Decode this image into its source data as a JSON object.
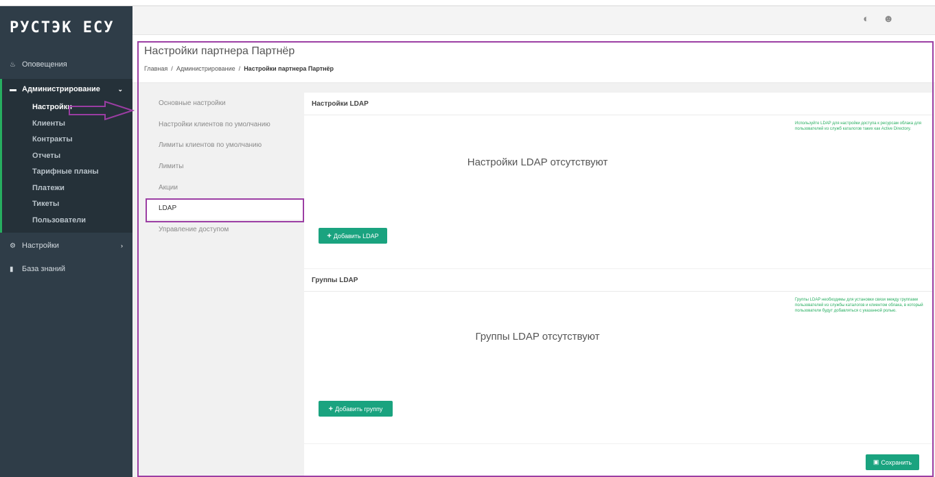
{
  "brand": {
    "logo": "РУСТЭК ЕСУ"
  },
  "sidebar": {
    "notifications": "Оповещения",
    "admin": {
      "label": "Администрирование",
      "items": [
        "Настройки",
        "Клиенты",
        "Контракты",
        "Отчеты",
        "Тарифные планы",
        "Платежи",
        "Тикеты",
        "Пользователи"
      ]
    },
    "settings": "Настройки",
    "knowledge": "База знаний"
  },
  "topbar": {
    "icons": [
      "theme-toggle-icon",
      "user-icon"
    ]
  },
  "page": {
    "title": "Настройки партнера Партнёр",
    "breadcrumb": {
      "home": "Главная",
      "admin": "Администрирование",
      "current": "Настройки партнера Партнёр",
      "sep": "/"
    }
  },
  "subnav": {
    "items": [
      "Основные настройки",
      "Настройки клиентов по умолчанию",
      "Лимиты клиентов по умолчанию",
      "Лимиты",
      "Акции",
      "LDAP",
      "Управление доступом"
    ],
    "active_index": 5
  },
  "ldap": {
    "header": "Настройки LDAP",
    "empty": "Настройки LDAP отсутствуют",
    "hint": "Используйте LDAP для настройки доступа к ресурсам облака для пользователей из служб каталогов таких как Active Directory.",
    "add_button": "Добавить LDAP"
  },
  "groups": {
    "header": "Группы LDAP",
    "empty": "Группы LDAP отсутствуют",
    "hint": "Группы LDAP необходимы для установки связи между группами пользователей из службы каталогов и клиентом облака, в который пользователи будут добавляться с указанной ролью.",
    "add_button": "Добавить группу"
  },
  "footer": {
    "save_button": "Сохранить"
  },
  "colors": {
    "sidebar": "#2f3d48",
    "accent_green": "#1aa37f",
    "highlight": "#9b3da3"
  }
}
